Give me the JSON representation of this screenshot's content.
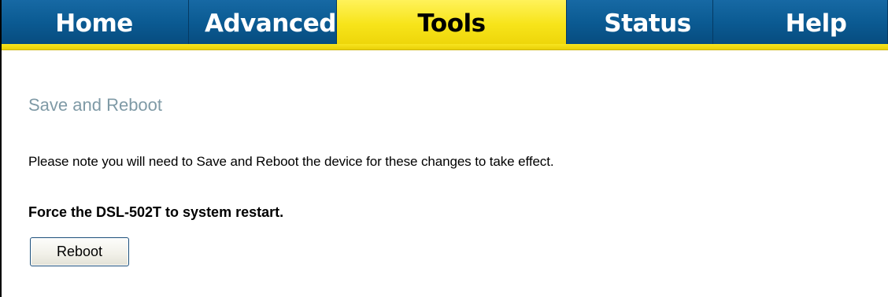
{
  "nav": {
    "tabs": [
      {
        "label": "Home",
        "active": false
      },
      {
        "label": "Advanced",
        "active": false
      },
      {
        "label": "Tools",
        "active": true
      },
      {
        "label": "Status",
        "active": false
      },
      {
        "label": "Help",
        "active": false
      }
    ]
  },
  "main": {
    "title": "Save and Reboot",
    "note": "Please note you will need to Save and Reboot the device for these changes to take effect.",
    "force_label": "Force the DSL-502T to system restart.",
    "reboot_button": "Reboot"
  },
  "colors": {
    "tab_blue": "#0b5b93",
    "tab_active_yellow": "#f7e41a",
    "title_gray": "#7f9aa6"
  }
}
